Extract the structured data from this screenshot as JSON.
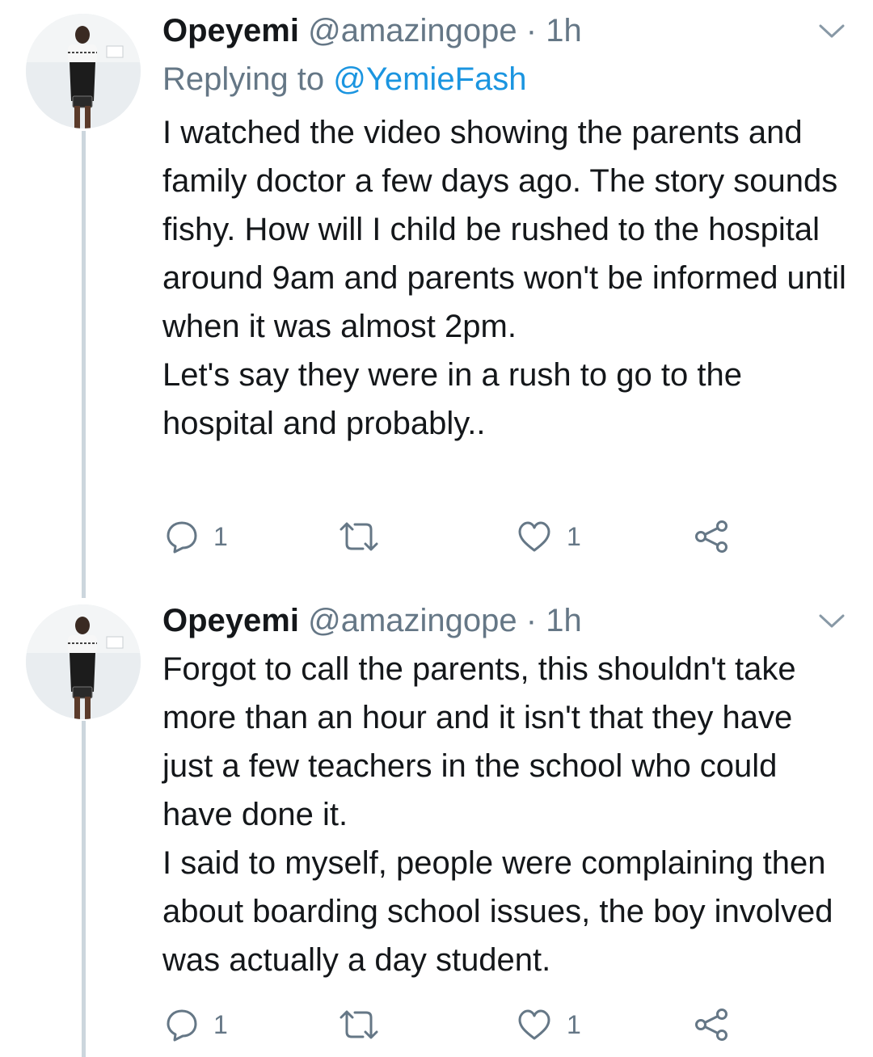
{
  "colors": {
    "text": "#14171a",
    "secondary": "#657786",
    "link": "#1b95e0",
    "thread_line": "#ccd6dd"
  },
  "tweets": [
    {
      "display_name": "Opeyemi",
      "handle": "@amazingope",
      "separator": "·",
      "time": "1h",
      "replying_prefix": "Replying to",
      "replying_to": "@YemieFash",
      "paragraphs": [
        "I watched the video showing the parents and family doctor a few days ago. The story sounds fishy. How will I child be rushed to the hospital around 9am and parents won't be informed until when it was almost 2pm.",
        "Let's say they were in a rush to go to the hospital and probably.."
      ],
      "reply_count": "1",
      "like_count": "1",
      "icons": [
        "avatar",
        "chevron-down-icon",
        "reply-icon",
        "retweet-icon",
        "like-icon",
        "share-icon"
      ]
    },
    {
      "display_name": "Opeyemi",
      "handle": "@amazingope",
      "separator": "·",
      "time": "1h",
      "paragraphs": [
        "Forgot to call the parents, this shouldn't take more than an hour and it isn't that they have just a few teachers in the school who could have done it.",
        "I said to myself, people were complaining then about boarding school issues, the boy involved was actually a day student."
      ],
      "reply_count": "1",
      "like_count": "1",
      "icons": [
        "avatar",
        "chevron-down-icon",
        "reply-icon",
        "retweet-icon",
        "like-icon",
        "share-icon"
      ]
    }
  ]
}
